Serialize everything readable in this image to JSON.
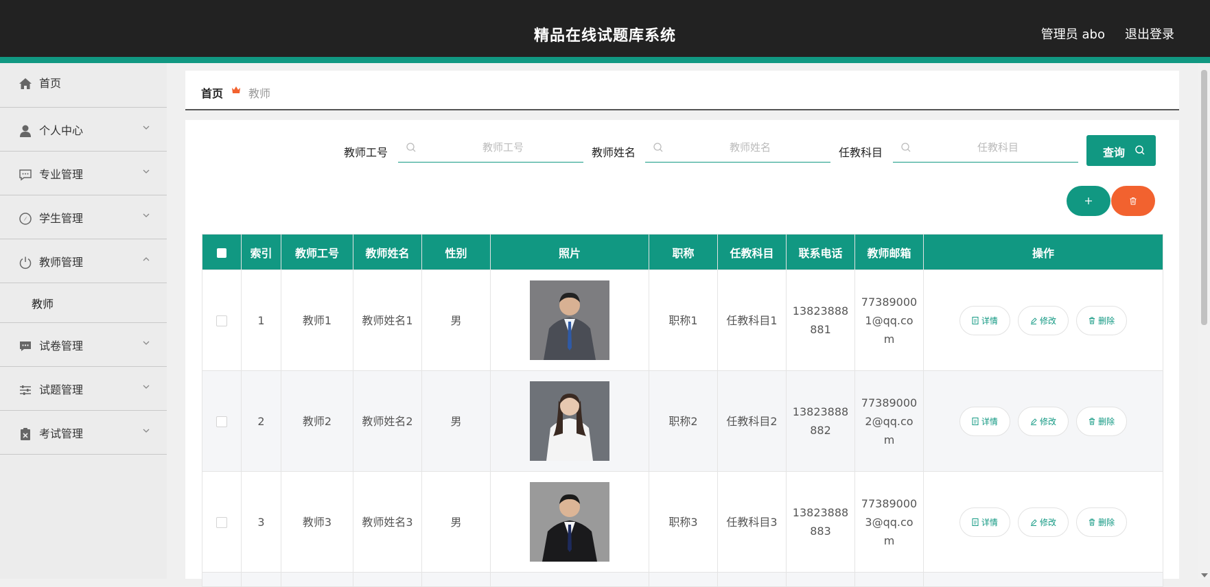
{
  "app": {
    "title": "精品在线试题库系统",
    "user": "管理员 abo",
    "logout": "退出登录"
  },
  "sidebar": {
    "items": [
      {
        "label": "首页",
        "icon": "home-icon"
      },
      {
        "label": "个人中心",
        "icon": "user-icon"
      },
      {
        "label": "专业管理",
        "icon": "chat-icon"
      },
      {
        "label": "学生管理",
        "icon": "compass-icon"
      },
      {
        "label": "教师管理",
        "icon": "power-icon",
        "expanded": true
      },
      {
        "label": "试卷管理",
        "icon": "message-icon"
      },
      {
        "label": "试题管理",
        "icon": "sliders-icon"
      },
      {
        "label": "考试管理",
        "icon": "clipboard-icon"
      }
    ],
    "subitem": "教师"
  },
  "breadcrumb": {
    "home": "首页",
    "current": "教师"
  },
  "search": {
    "fields": [
      {
        "label": "教师工号",
        "placeholder": "教师工号"
      },
      {
        "label": "教师姓名",
        "placeholder": "教师姓名"
      },
      {
        "label": "任教科目",
        "placeholder": "任教科目"
      }
    ],
    "query_button": "查询"
  },
  "table": {
    "headers": [
      "索引",
      "教师工号",
      "教师姓名",
      "性别",
      "照片",
      "职称",
      "任教科目",
      "联系电话",
      "教师邮箱",
      "操作"
    ],
    "rows": [
      {
        "index": "1",
        "id": "教师1",
        "name": "教师姓名1",
        "gender": "男",
        "title": "职称1",
        "subject": "任教科目1",
        "phone": "13823888881",
        "email": "773890001@qq.com"
      },
      {
        "index": "2",
        "id": "教师2",
        "name": "教师姓名2",
        "gender": "男",
        "title": "职称2",
        "subject": "任教科目2",
        "phone": "13823888882",
        "email": "773890002@qq.com"
      },
      {
        "index": "3",
        "id": "教师3",
        "name": "教师姓名3",
        "gender": "男",
        "title": "职称3",
        "subject": "任教科目3",
        "phone": "13823888883",
        "email": "773890003@qq.com"
      }
    ],
    "actions": {
      "detail": "详情",
      "edit": "修改",
      "delete": "删除"
    }
  },
  "colors": {
    "accent": "#119882",
    "danger": "#f2622f",
    "topbar": "#222222"
  }
}
